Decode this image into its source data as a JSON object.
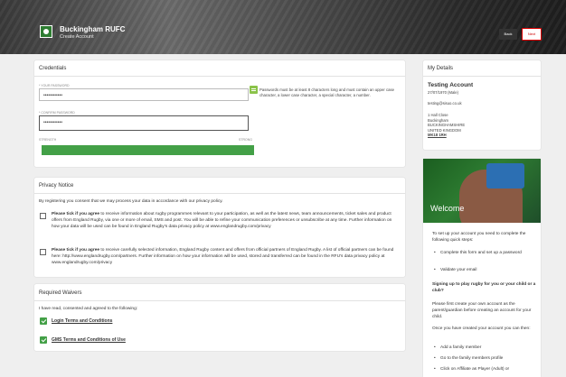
{
  "header": {
    "club_name": "Buckingham RUFC",
    "subtitle": "Create Account",
    "back_label": "Back",
    "next_label": "Next"
  },
  "credentials": {
    "title": "Credentials",
    "password_label": "* YOUR PASSWORD",
    "password_value": "••••••••••••",
    "confirm_label": "* CONFIRM PASSWORD",
    "confirm_value": "••••••••••••",
    "hint": "Passwords must be at least 8 characters long and must contain an upper case character, a lower case character, a special character, a number.",
    "strength_label": "STRENGTH",
    "strength_value_label": "STRONG",
    "strength_level": 1.0
  },
  "privacy": {
    "title": "Privacy Notice",
    "intro": "By registering you consent that we may process your data in accordance with our privacy policy.",
    "consent1_bold": "Please tick if you agree",
    "consent1_text": " to receive information about rugby programmes relevant to your participation, as well as the latest news, team announcements, ticket sales and product offers from England Rugby, via one or more of email, SMS and post. You will be able to refine your communication preferences or unsubscribe at any time. Further information on how your data will be used can be found in England Rugby's data privacy policy at www.englandrugby.com/privacy",
    "consent2_bold": "Please tick if you agree",
    "consent2_text": " to receive carefully selected information, England Rugby content and offers from official partners of England Rugby. A list of official partners can be found here: http://www.englandrugby.com/partners. Further information on how your information will be used, stored and transferred can be found in the RFU's data privacy policy at www.englandrugby.com/privacy"
  },
  "waivers": {
    "title": "Required Waivers",
    "intro": "I have read, consented and agreed to the following:",
    "items": [
      "Login Terms and Conditions",
      "GMS Terms and Conditions of Use"
    ]
  },
  "my_details": {
    "title": "My Details",
    "name": "Testing Account",
    "dob": "27/07/1970 (Male)",
    "email": "testing@sisuo.co.uk",
    "address": [
      "1 Hall Close",
      "Buckingham",
      "BUCKINGHAMSHIRE",
      "UNITED KINGDOM",
      "MK18 1RH"
    ]
  },
  "welcome": {
    "title": "Welcome",
    "intro": "To set up your account you need to complete the following quick steps:",
    "steps": [
      "Complete this form and set up a password",
      "Validate your email"
    ],
    "q": "Signing up to play rugby for you or your child or a club?",
    "para1": "Please first create your own account as the parent/guardian before creating an account for your child.",
    "para2": "Once you have created your account you can then:",
    "actions": [
      "Add a family member",
      "Go to the family members profile",
      "Click on Affiliate as Player (Adult) or"
    ]
  }
}
